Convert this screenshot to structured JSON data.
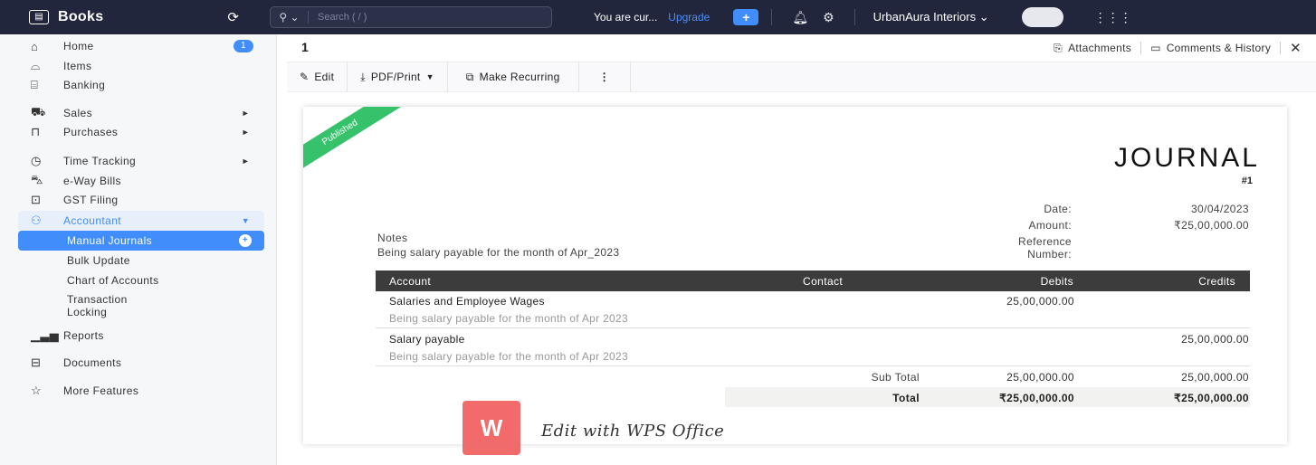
{
  "topbar": {
    "brand": "Books",
    "search_placeholder": "Search ( / )",
    "trial_text": "You are cur...",
    "upgrade_label": "Upgrade",
    "org_name": "UrbanAura Interiors ⌄"
  },
  "sidebar": {
    "home": "Home",
    "home_badge": "1",
    "items": "Items",
    "banking": "Banking",
    "sales": "Sales",
    "purchases": "Purchases",
    "time_tracking": "Time Tracking",
    "eway_bills": "e-Way Bills",
    "gst_filing": "GST Filing",
    "accountant": "Accountant",
    "sub": {
      "manual_journals": "Manual Journals",
      "bulk_update": "Bulk Update",
      "chart_of_accounts": "Chart of Accounts",
      "transaction_locking_1": "Transaction",
      "transaction_locking_2": "Locking"
    },
    "reports": "Reports",
    "documents": "Documents",
    "more_features": "More Features"
  },
  "header": {
    "journal_number": "1",
    "attachments": "Attachments",
    "comments_history": "Comments & History"
  },
  "toolbar": {
    "edit": "Edit",
    "pdf_print": "PDF/Print",
    "make_recurring": "Make Recurring"
  },
  "document": {
    "status_ribbon": "Published",
    "title": "JOURNAL",
    "number": "#1",
    "date_label": "Date:",
    "date_value": "30/04/2023",
    "amount_label": "Amount:",
    "amount_value": "₹25,00,000.00",
    "reference_label_1": "Reference",
    "reference_label_2": "Number:",
    "notes_heading": "Notes",
    "notes_text": "Being salary payable for the month of Apr_2023",
    "table": {
      "headers": {
        "account": "Account",
        "contact": "Contact",
        "debits": "Debits",
        "credits": "Credits"
      },
      "rows": [
        {
          "account": "Salaries and Employee Wages",
          "description": "Being salary payable for the month of Apr 2023",
          "debit": "25,00,000.00",
          "credit": ""
        },
        {
          "account": "Salary payable",
          "description": "Being salary payable for the month of Apr 2023",
          "debit": "",
          "credit": "25,00,000.00"
        }
      ],
      "subtotal_label": "Sub Total",
      "subtotal_debit": "25,00,000.00",
      "subtotal_credit": "25,00,000.00",
      "total_label": "Total",
      "total_debit": "₹25,00,000.00",
      "total_credit": "₹25,00,000.00"
    }
  },
  "watermark": {
    "logo_letter": "W",
    "text": "Edit with WPS Office"
  },
  "colors": {
    "topbar": "#21263c",
    "accent": "#408dfb",
    "published": "#36c26a",
    "table_header": "#3c3c3c"
  }
}
